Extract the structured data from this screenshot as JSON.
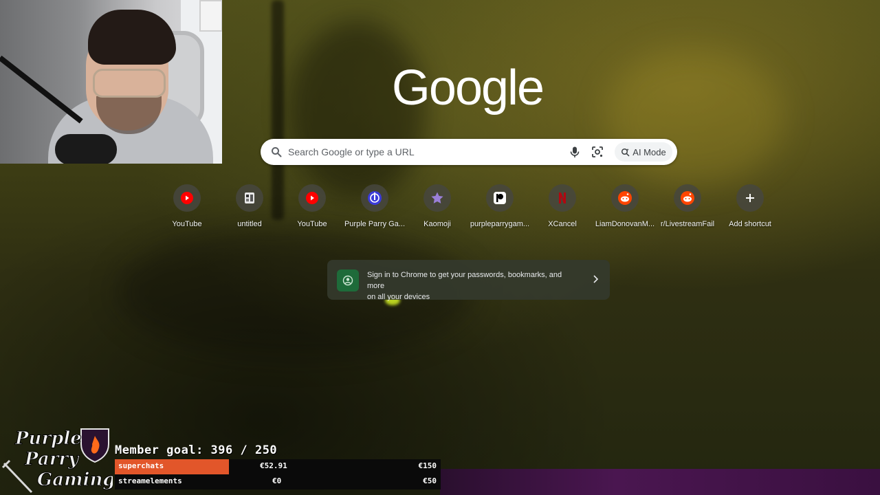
{
  "search": {
    "placeholder": "Search Google or type a URL",
    "ai_mode_label": "AI Mode"
  },
  "logo": {
    "text": "Google"
  },
  "shortcuts": [
    {
      "label": "YouTube",
      "icon": "youtube-icon",
      "color": "#ff0000"
    },
    {
      "label": "untitled",
      "icon": "document-icon",
      "color": "#e8e8e8"
    },
    {
      "label": "YouTube",
      "icon": "youtube-icon",
      "color": "#ff0000"
    },
    {
      "label": "Purple Parry Ga...",
      "icon": "purple-parry-icon",
      "color": "#3b3bd9"
    },
    {
      "label": "Kaomoji",
      "icon": "star-icon",
      "color": "#9a7fd8"
    },
    {
      "label": "purpleparrygam...",
      "icon": "patreon-icon",
      "color": "#000000"
    },
    {
      "label": "XCancel",
      "icon": "netflix-icon",
      "color": "#b20710"
    },
    {
      "label": "LiamDonovanM...",
      "icon": "reddit-icon",
      "color": "#ff4500"
    },
    {
      "label": "r/LivestreamFail",
      "icon": "reddit-icon",
      "color": "#ff4500"
    },
    {
      "label": "Add shortcut",
      "icon": "plus-icon",
      "color": "#ffffff"
    }
  ],
  "signin": {
    "line1": "Sign in to Chrome to get your passwords, bookmarks, and more",
    "line2": "on all your devices"
  },
  "overlay": {
    "logo_lines": [
      "Purple",
      "Parry",
      "Gaming"
    ],
    "member_goal": "Member goal: 396 / 250",
    "bars": [
      {
        "name": "superchats",
        "current": "€52.91",
        "goal": "€150",
        "progress": 0.35
      },
      {
        "name": "streamelements",
        "current": "€0",
        "goal": "€50",
        "progress": 0.0
      }
    ]
  }
}
